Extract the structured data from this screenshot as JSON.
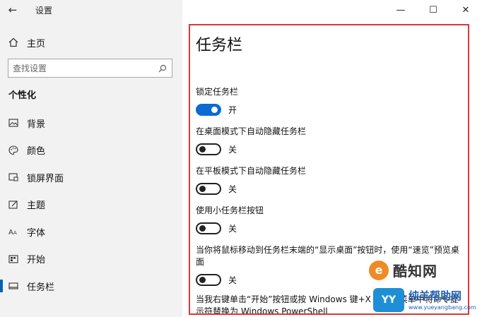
{
  "window": {
    "title": "设置",
    "back": "←",
    "controls": {
      "minimize": "—",
      "maximize": "☐",
      "close": "✕"
    }
  },
  "sidebar": {
    "home_label": "主页",
    "search_placeholder": "查找设置",
    "section_heading": "个性化",
    "items": [
      {
        "label": "背景",
        "icon": "image-icon",
        "selected": false
      },
      {
        "label": "颜色",
        "icon": "palette-icon",
        "selected": false
      },
      {
        "label": "锁屏界面",
        "icon": "lock-screen-icon",
        "selected": false
      },
      {
        "label": "主题",
        "icon": "theme-icon",
        "selected": false
      },
      {
        "label": "字体",
        "icon": "font-icon",
        "selected": false
      },
      {
        "label": "开始",
        "icon": "start-icon",
        "selected": false
      },
      {
        "label": "任务栏",
        "icon": "taskbar-icon",
        "selected": true
      }
    ]
  },
  "content": {
    "title": "任务栏",
    "settings": [
      {
        "label": "锁定任务栏",
        "state": "开",
        "on": true
      },
      {
        "label": "在桌面模式下自动隐藏任务栏",
        "state": "关",
        "on": false
      },
      {
        "label": "在平板模式下自动隐藏任务栏",
        "state": "关",
        "on": false
      },
      {
        "label": "使用小任务栏按钮",
        "state": "关",
        "on": false
      },
      {
        "label": "当你将鼠标移动到任务栏末端的“显示桌面”按钮时，使用“速览”预览桌面",
        "state": "关",
        "on": false
      }
    ],
    "partial_text": "当我右键单击“开始”按钮或按 Windows 键+X 时，在菜单中将命令提示符替换为 Windows PowerShell"
  },
  "watermarks": {
    "wm1_logo": "e",
    "wm1_text": "酷知网",
    "wm2_logo": "YY",
    "wm2_text": "纯羊帮助网",
    "wm2_url": "www.yueyangbang.com"
  },
  "colors": {
    "accent": "#0a6bd1",
    "sidebar_bg": "#f2f2f2",
    "highlight_border": "#d93a3a"
  }
}
